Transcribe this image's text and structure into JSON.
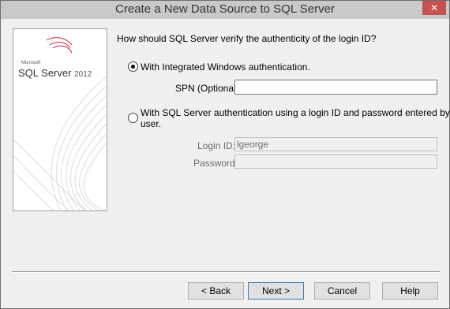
{
  "window": {
    "title": "Create a New Data Source to SQL Server",
    "close_icon": "close-icon",
    "close_glyph": "✕"
  },
  "logo": {
    "maker": "Microsoft",
    "product": "SQL Server",
    "version": "2012"
  },
  "auth": {
    "question": "How should SQL Server verify the authenticity of the login ID?",
    "windows_option": "With Integrated Windows authentication.",
    "spn_label": "SPN (Optional):",
    "spn_value": "",
    "sql_option_line1": "With SQL Server authentication using a login ID and password entered by the",
    "sql_option_line2": "user.",
    "login_label": "Login ID:",
    "login_value": "lgeorge",
    "password_label": "Password:",
    "password_value": "",
    "selected": "windows"
  },
  "buttons": {
    "back": "< Back",
    "next": "Next >",
    "cancel": "Cancel",
    "help": "Help"
  },
  "colors": {
    "close_button": "#c75050",
    "titlebar": "#c9c9c9",
    "window_bg": "#f0f0f0"
  }
}
